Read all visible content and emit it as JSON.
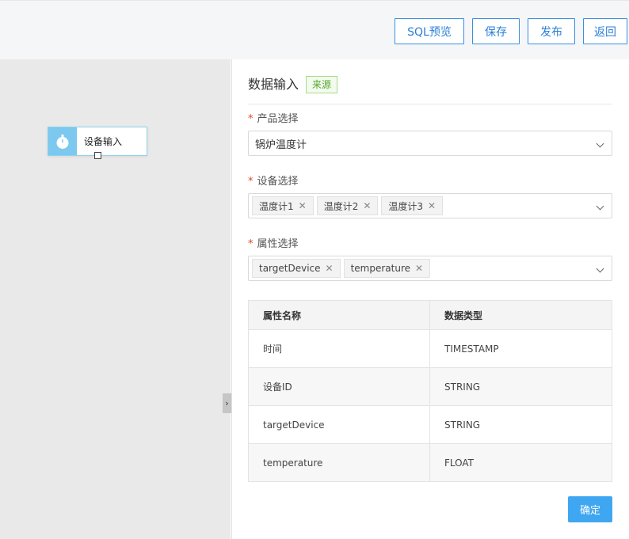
{
  "toolbar": {
    "sql_preview_label": "SQL预览",
    "save_label": "保存",
    "publish_label": "发布",
    "back_label": "返回"
  },
  "canvas": {
    "node": {
      "label": "设备输入",
      "icon": "device-icon"
    },
    "collapse_icon": "chevron-right-icon"
  },
  "panel": {
    "title": "数据输入",
    "tag": "来源",
    "product": {
      "label": "产品选择",
      "value": "锅炉温度计"
    },
    "device": {
      "label": "设备选择",
      "chips": [
        "温度计1",
        "温度计2",
        "温度计3"
      ]
    },
    "attribute": {
      "label": "属性选择",
      "chips": [
        "targetDevice",
        "temperature"
      ]
    },
    "table": {
      "headers": [
        "属性名称",
        "数据类型"
      ],
      "rows": [
        [
          "时间",
          "TIMESTAMP"
        ],
        [
          "设备ID",
          "STRING"
        ],
        [
          "targetDevice",
          "STRING"
        ],
        [
          "temperature",
          "FLOAT"
        ]
      ]
    },
    "confirm_label": "确定"
  },
  "colors": {
    "accent": "#3a8fe0",
    "confirm": "#3fa7f1",
    "tag_green": "#55a532",
    "canvas_bg": "#e9e9e9",
    "node_icon_bg": "#7cc8ee"
  }
}
